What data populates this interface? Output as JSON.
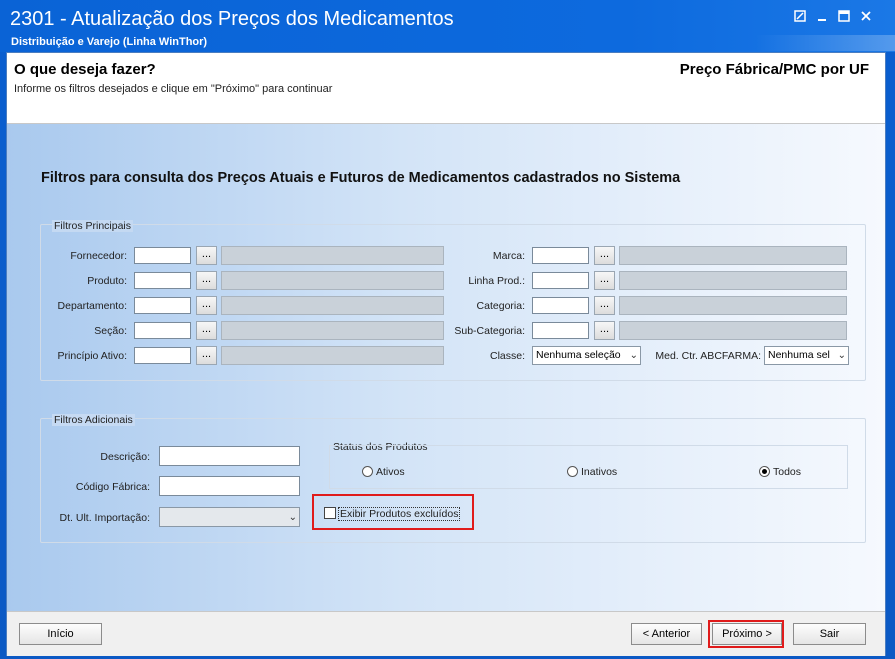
{
  "window": {
    "title": "2301 - Atualização dos Preços dos Medicamentos",
    "subtitle": "Distribuição e Varejo (Linha WinThor)"
  },
  "header": {
    "question": "O que deseja fazer?",
    "instruction": "Informe os filtros desejados e clique em \"Próximo\" para continuar",
    "mode": "Preço Fábrica/PMC por UF"
  },
  "main": {
    "title": "Filtros para consulta dos Preços Atuais e Futuros de Medicamentos cadastrados no Sistema"
  },
  "principais": {
    "legend": "Filtros Principais",
    "left": [
      {
        "label": "Fornecedor:"
      },
      {
        "label": "Produto:"
      },
      {
        "label": "Departamento:"
      },
      {
        "label": "Seção:"
      },
      {
        "label": "Princípio Ativo:"
      }
    ],
    "right": [
      {
        "label": "Marca:"
      },
      {
        "label": "Linha Prod.:"
      },
      {
        "label": "Categoria:"
      },
      {
        "label": "Sub-Categoria:"
      }
    ],
    "lookup_button": "...",
    "classe_label": "Classe:",
    "classe_value": "Nenhuma seleção",
    "abcfarma_label": "Med. Ctr. ABCFARMA:",
    "abcfarma_value": "Nenhuma sel"
  },
  "adicionais": {
    "legend": "Filtros Adicionais",
    "descricao_label": "Descrição:",
    "codigo_label": "Código Fábrica:",
    "dt_label": "Dt. Ult. Importação:",
    "status_legend": "Status dos Produtos",
    "status_options": [
      "Ativos",
      "Inativos",
      "Todos"
    ],
    "status_selected": "Todos",
    "excluidos_label": "Exibir Produtos excluídos"
  },
  "footer": {
    "inicio": "Início",
    "anterior": "< Anterior",
    "proximo": "Próximo >",
    "sair": "Sair"
  }
}
